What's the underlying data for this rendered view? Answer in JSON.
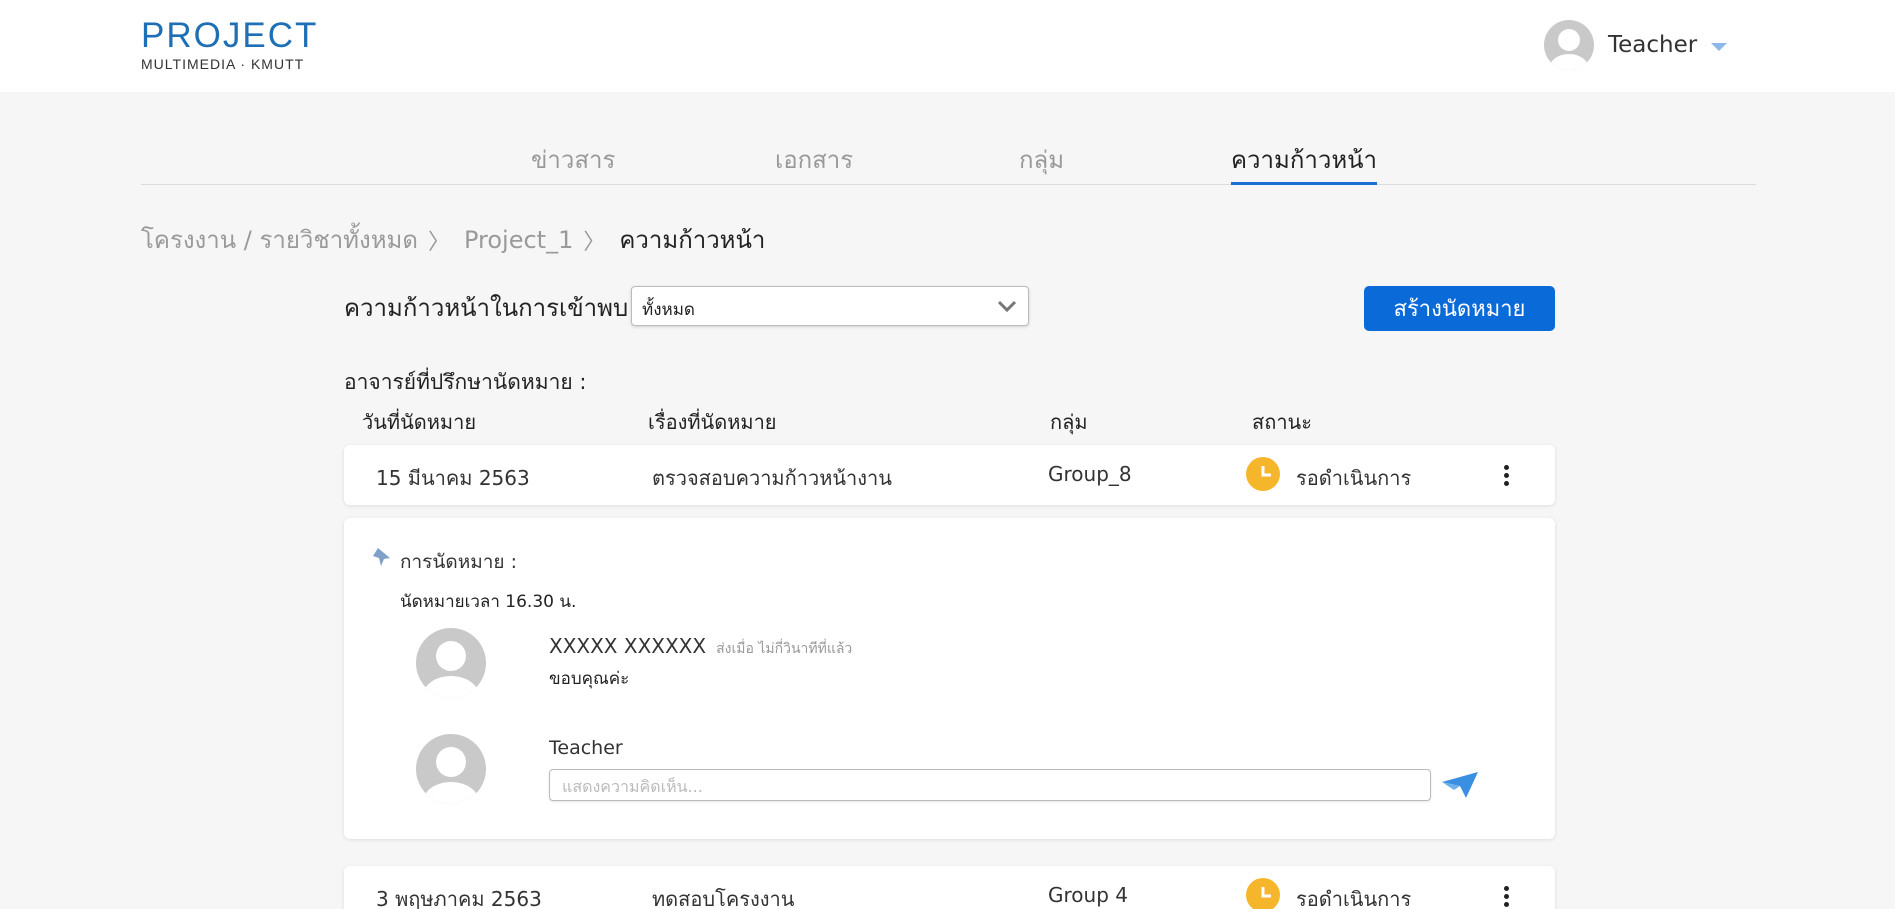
{
  "header": {
    "logo_main": "PROJECT",
    "logo_sub": "MULTIMEDIA · KMUTT",
    "user_name": "Teacher"
  },
  "tabs": [
    {
      "label": "ข่าวสาร",
      "active": false
    },
    {
      "label": "เอกสาร",
      "active": false
    },
    {
      "label": "กลุ่ม",
      "active": false
    },
    {
      "label": "ความก้าวหน้า",
      "active": true
    }
  ],
  "breadcrumb": {
    "items": [
      "โครงงาน / รายวิชาทั้งหมด",
      "Project_1"
    ],
    "current": "ความก้าวหน้า",
    "separator": "〉"
  },
  "filter": {
    "label": "ความก้าวหน้าในการเข้าพบ",
    "selected": "ทั้งหมด"
  },
  "create_button": "สร้างนัดหมาย",
  "advisor_label": "อาจารย์ที่ปรึกษานัดหมาย :",
  "columns": [
    "วันที่นัดหมาย",
    "เรื่องที่นัดหมาย",
    "กลุ่ม",
    "สถานะ"
  ],
  "appointments": [
    {
      "date": "15 มีนาคม 2563",
      "topic": "ตรวจสอบความก้าวหน้างาน",
      "group": "Group_8",
      "status": "รอดำเนินการ"
    },
    {
      "date": "3 พฤษภาคม 2563",
      "topic": "ทดสอบโครงงาน",
      "group": "Group 4",
      "status": "รอดำเนินการ"
    }
  ],
  "detail": {
    "label": "การนัดหมาย :",
    "time_note": "นัดหมายเวลา 16.30 น.",
    "comment": {
      "author": "XXXXX XXXXXX",
      "sent_time": "ส่งเมื่อ ไม่กี่วินาทีที่แล้ว",
      "text": "ขอบคุณค่ะ"
    },
    "reply_author": "Teacher",
    "input_placeholder": "แสดงความคิดเห็น..."
  },
  "colors": {
    "accent": "#0a6ad8",
    "status_pending": "#f6b62c",
    "logo": "#1e6fb5"
  },
  "icons": [
    "avatar-icon",
    "caret-down-icon",
    "chevron-down-icon",
    "clock-icon",
    "kebab-menu-icon",
    "pin-icon",
    "send-icon"
  ]
}
